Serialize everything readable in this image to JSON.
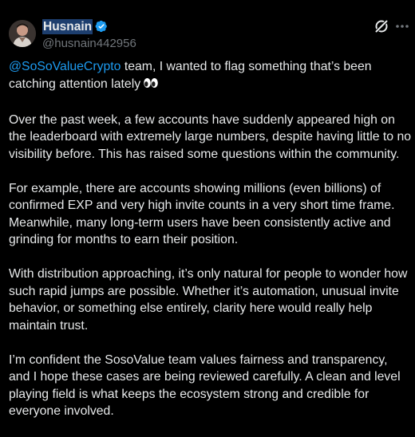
{
  "author": {
    "display_name": "Husnain",
    "handle": "@husnain442956",
    "verified": true,
    "verified_color": "#1d9bf0"
  },
  "icons": {
    "grok": "grok-icon",
    "more": "more-options-icon",
    "verified": "verified-badge-icon",
    "emoji": "eyes-emoji"
  },
  "tweet": {
    "mention": "@SoSoValueCrypto",
    "first_line_rest": " team, I wanted to flag something that’s been catching attention lately",
    "emoji": "👀",
    "paragraphs": [
      "Over the past week, a few accounts have suddenly appeared high on the leaderboard with extremely large numbers, despite having little to no visibility before. This has raised some questions within the community.",
      "For example, there are accounts showing millions (even billions) of confirmed EXP and very high invite counts in a very short time frame. Meanwhile, many long-term users have been consistently active and grinding for months to earn their position.",
      "With distribution approaching, it’s only natural for people to wonder how such rapid jumps are possible. Whether it’s automation, unusual invite behavior, or something else entirely, clarity here would really help maintain trust.",
      "I’m confident the SosoValue team values fairness and transparency, and I hope these cases are being reviewed carefully. A clean and level playing field is what keeps the ecosystem strong and credible for everyone involved."
    ]
  },
  "colors": {
    "background": "#000000",
    "text": "#e7e9ea",
    "secondary": "#71767b",
    "accent": "#1d9bf0"
  }
}
